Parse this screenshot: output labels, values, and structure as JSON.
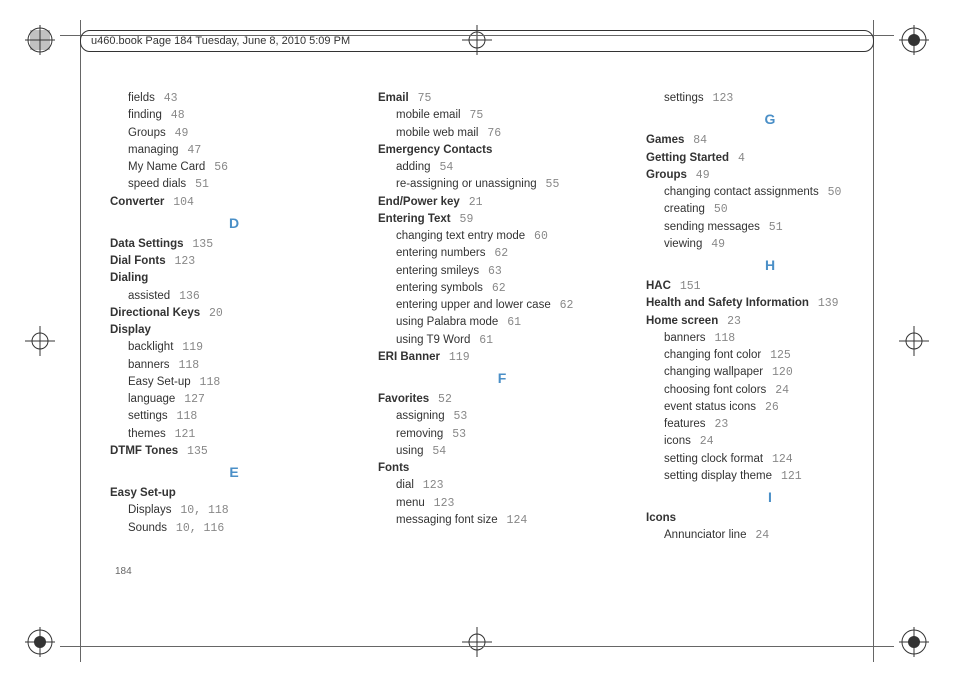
{
  "header": "u460.book  Page 184  Tuesday, June 8, 2010  5:09 PM",
  "page_number": "184",
  "columns": [
    [
      {
        "type": "sub",
        "text": "fields",
        "page": "43"
      },
      {
        "type": "sub",
        "text": "finding",
        "page": "48"
      },
      {
        "type": "sub",
        "text": "Groups",
        "page": "49"
      },
      {
        "type": "sub",
        "text": "managing",
        "page": "47"
      },
      {
        "type": "sub",
        "text": "My Name Card",
        "page": "56"
      },
      {
        "type": "sub",
        "text": "speed dials",
        "page": "51"
      },
      {
        "type": "main",
        "text": "Converter",
        "page": "104"
      },
      {
        "type": "sect",
        "text": "D"
      },
      {
        "type": "main",
        "text": "Data Settings",
        "page": "135"
      },
      {
        "type": "main",
        "text": "Dial Fonts",
        "page": "123"
      },
      {
        "type": "main",
        "text": "Dialing"
      },
      {
        "type": "sub",
        "text": "assisted",
        "page": "136"
      },
      {
        "type": "main",
        "text": "Directional Keys",
        "page": "20"
      },
      {
        "type": "main",
        "text": "Display"
      },
      {
        "type": "sub",
        "text": "backlight",
        "page": "119"
      },
      {
        "type": "sub",
        "text": "banners",
        "page": "118"
      },
      {
        "type": "sub",
        "text": "Easy Set-up",
        "page": "118"
      },
      {
        "type": "sub",
        "text": "language",
        "page": "127"
      },
      {
        "type": "sub",
        "text": "settings",
        "page": "118"
      },
      {
        "type": "sub",
        "text": "themes",
        "page": "121"
      },
      {
        "type": "main",
        "text": "DTMF Tones",
        "page": "135"
      },
      {
        "type": "sect",
        "text": "E"
      },
      {
        "type": "main",
        "text": "Easy Set-up"
      },
      {
        "type": "sub",
        "text": "Displays",
        "page": "10, 118"
      },
      {
        "type": "sub",
        "text": "Sounds",
        "page": "10, 116"
      }
    ],
    [
      {
        "type": "main",
        "text": "Email",
        "page": "75"
      },
      {
        "type": "sub",
        "text": "mobile email",
        "page": "75"
      },
      {
        "type": "sub",
        "text": "mobile web mail",
        "page": "76"
      },
      {
        "type": "main",
        "text": "Emergency Contacts"
      },
      {
        "type": "sub",
        "text": "adding",
        "page": "54"
      },
      {
        "type": "sub",
        "text": "re-assigning or unassigning",
        "page": "55"
      },
      {
        "type": "main",
        "text": "End/Power key",
        "page": "21"
      },
      {
        "type": "main",
        "text": "Entering Text",
        "page": "59"
      },
      {
        "type": "sub",
        "text": "changing text entry mode",
        "page": "60"
      },
      {
        "type": "sub",
        "text": "entering numbers",
        "page": "62"
      },
      {
        "type": "sub",
        "text": "entering smileys",
        "page": "63"
      },
      {
        "type": "sub",
        "text": "entering symbols",
        "page": "62"
      },
      {
        "type": "sub",
        "text": "entering upper and lower case",
        "page": "62"
      },
      {
        "type": "sub",
        "text": "using Palabra mode",
        "page": "61"
      },
      {
        "type": "sub",
        "text": "using T9 Word",
        "page": "61"
      },
      {
        "type": "main",
        "text": "ERI Banner",
        "page": "119"
      },
      {
        "type": "sect",
        "text": "F"
      },
      {
        "type": "main",
        "text": "Favorites",
        "page": "52"
      },
      {
        "type": "sub",
        "text": "assigning",
        "page": "53"
      },
      {
        "type": "sub",
        "text": "removing",
        "page": "53"
      },
      {
        "type": "sub",
        "text": "using",
        "page": "54"
      },
      {
        "type": "main",
        "text": "Fonts"
      },
      {
        "type": "sub",
        "text": "dial",
        "page": "123"
      },
      {
        "type": "sub",
        "text": "menu",
        "page": "123"
      },
      {
        "type": "sub",
        "text": "messaging font size",
        "page": "124"
      }
    ],
    [
      {
        "type": "sub",
        "text": "settings",
        "page": "123"
      },
      {
        "type": "sect",
        "text": "G"
      },
      {
        "type": "main",
        "text": "Games",
        "page": "84"
      },
      {
        "type": "main",
        "text": "Getting Started",
        "page": "4"
      },
      {
        "type": "main",
        "text": "Groups",
        "page": "49"
      },
      {
        "type": "sub",
        "text": "changing contact assignments",
        "page": "50"
      },
      {
        "type": "sub",
        "text": "creating",
        "page": "50"
      },
      {
        "type": "sub",
        "text": "sending messages",
        "page": "51"
      },
      {
        "type": "sub",
        "text": "viewing",
        "page": "49"
      },
      {
        "type": "sect",
        "text": "H"
      },
      {
        "type": "main",
        "text": "HAC",
        "page": "151"
      },
      {
        "type": "main",
        "text": "Health and Safety Information",
        "page": "139"
      },
      {
        "type": "main",
        "text": "Home screen",
        "page": "23"
      },
      {
        "type": "sub",
        "text": "banners",
        "page": "118"
      },
      {
        "type": "sub",
        "text": "changing font color",
        "page": "125"
      },
      {
        "type": "sub",
        "text": "changing wallpaper",
        "page": "120"
      },
      {
        "type": "sub",
        "text": "choosing font colors",
        "page": "24"
      },
      {
        "type": "sub",
        "text": "event status icons",
        "page": "26"
      },
      {
        "type": "sub",
        "text": "features",
        "page": "23"
      },
      {
        "type": "sub",
        "text": "icons",
        "page": "24"
      },
      {
        "type": "sub",
        "text": "setting clock format",
        "page": "124"
      },
      {
        "type": "sub",
        "text": "setting display theme",
        "page": "121"
      },
      {
        "type": "sect",
        "text": "I"
      },
      {
        "type": "main",
        "text": "Icons"
      },
      {
        "type": "sub",
        "text": "Annunciator line",
        "page": "24"
      }
    ]
  ]
}
